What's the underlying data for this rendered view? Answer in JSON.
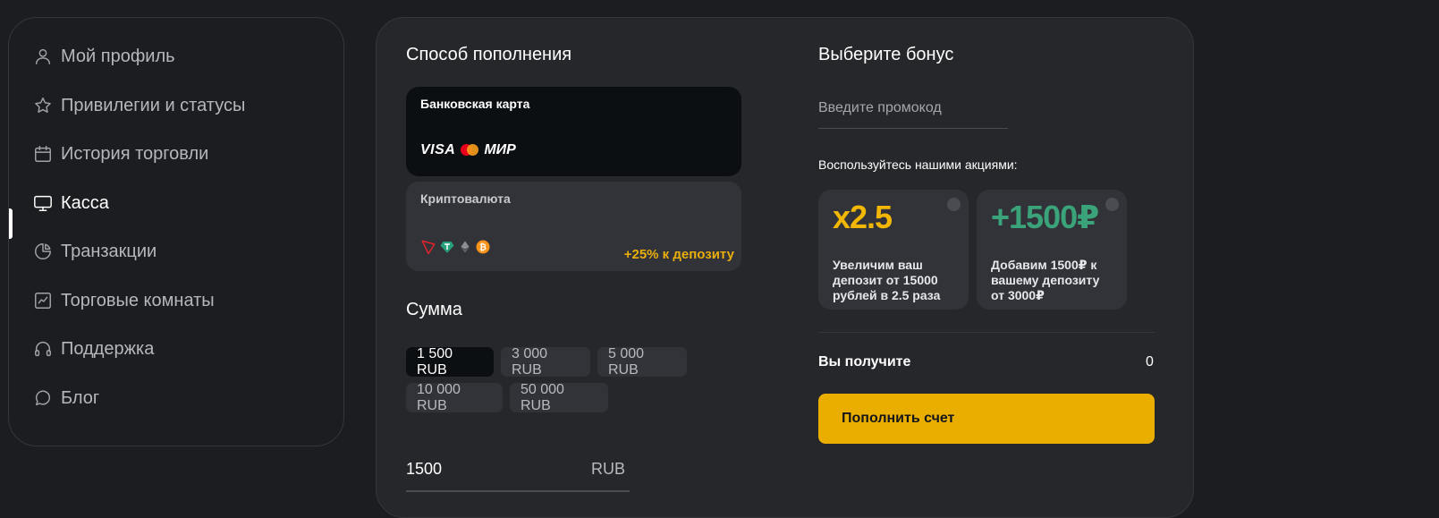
{
  "sidebar": {
    "items": [
      {
        "label": "Мой профиль",
        "icon": "user-icon"
      },
      {
        "label": "Привилегии и статусы",
        "icon": "star-icon"
      },
      {
        "label": "История торговли",
        "icon": "calendar-icon"
      },
      {
        "label": "Касса",
        "icon": "monitor-icon",
        "active": true
      },
      {
        "label": "Транзакции",
        "icon": "pie-chart-icon"
      },
      {
        "label": "Торговые комнаты",
        "icon": "chart-line-icon"
      },
      {
        "label": "Поддержка",
        "icon": "headphones-icon"
      },
      {
        "label": "Блог",
        "icon": "chat-bubble-icon"
      }
    ]
  },
  "payment": {
    "title": "Способ пополнения",
    "methods": [
      {
        "title": "Банковская карта",
        "logos": [
          "VISA",
          "МИР"
        ],
        "selected": true
      },
      {
        "title": "Криптовалюта",
        "bonus": "+25% к депозиту"
      }
    ]
  },
  "amount": {
    "title": "Сумма",
    "presets": [
      "1 500 RUB",
      "3 000 RUB",
      "5 000 RUB",
      "10 000 RUB",
      "50 000 RUB"
    ],
    "active_preset": 0,
    "value": "1500",
    "currency": "RUB"
  },
  "bonus": {
    "title": "Выберите бонус",
    "promo_placeholder": "Введите промокод",
    "promo_label": "Воспользуйтесь нашими акциями:",
    "offers": [
      {
        "headline": "x2.5",
        "description": "Увеличим ваш депозит от 15000 рублей в 2.5 раза",
        "color": "#f2b705"
      },
      {
        "headline": "+1500₽",
        "description": "Добавим 1500₽ к вашему депозиту от 3000₽",
        "color": "#3aa37a"
      }
    ]
  },
  "summary": {
    "receive_label": "Вы получите",
    "receive_value": "0",
    "submit_label": "Пополнить счет"
  },
  "colors": {
    "accent": "#e9ae00",
    "background": "#1c1d20",
    "panel": "#26272b"
  }
}
